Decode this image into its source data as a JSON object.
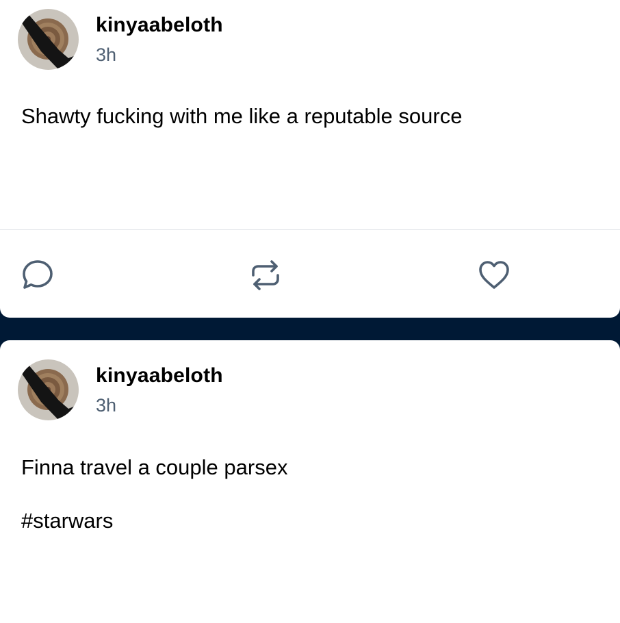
{
  "posts": [
    {
      "username": "kinyaabeloth",
      "timestamp": "3h",
      "avatar_icon": "manhole-cover-avatar",
      "body": "Shawty fucking with me like a reputable source",
      "actions": [
        {
          "icon": "comment-icon"
        },
        {
          "icon": "reblog-icon"
        },
        {
          "icon": "heart-icon"
        }
      ]
    },
    {
      "username": "kinyaabeloth",
      "timestamp": "3h",
      "avatar_icon": "manhole-cover-avatar",
      "body": "Finna travel a couple parsex",
      "tag": "#starwars"
    }
  ],
  "colors": {
    "background": "#001935",
    "card": "#ffffff",
    "text": "#000000",
    "muted": "#4e5f72",
    "icon": "#4e5f72"
  }
}
